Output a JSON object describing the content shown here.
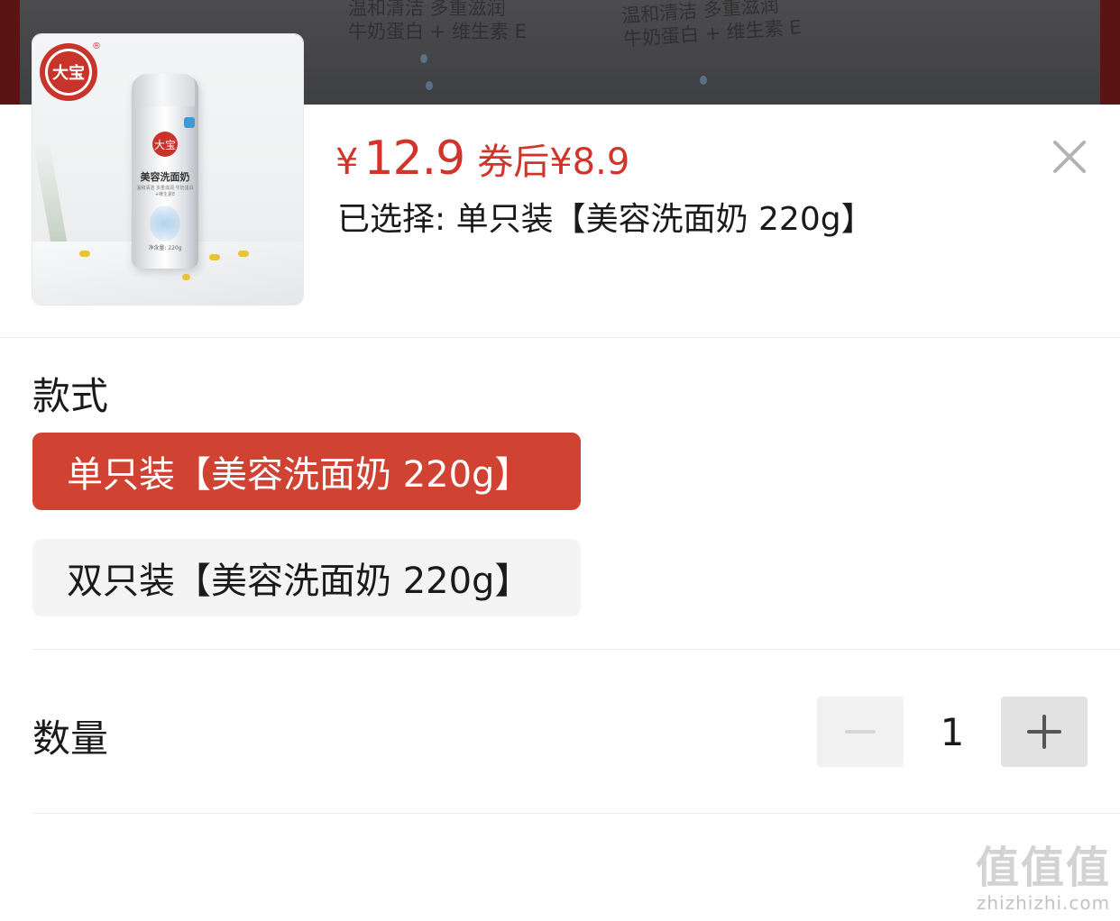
{
  "backdrop": {
    "line1": "温和清洁 多重滋润",
    "line2": "牛奶蛋白 + 维生素 E"
  },
  "product": {
    "image_icon": "product-bottle-image",
    "brand_logo_text": "大宝",
    "registered_mark": "®",
    "bottle_title": "美容洗面奶",
    "bottle_subtitle": "温和清洁 多重滋润 牛奶蛋白+维生素E",
    "bottle_net": "净含量: 220g"
  },
  "price": {
    "currency": "¥",
    "amount": "12.9",
    "coupon_label": "券后¥8.9"
  },
  "selected_text": "已选择: 单只装【美容洗面奶 220g】",
  "close_icon": "close-icon",
  "style_section": {
    "title": "款式",
    "options": [
      {
        "label": "单只装【美容洗面奶 220g】",
        "selected": true
      },
      {
        "label": "双只装【美容洗面奶 220g】",
        "selected": false
      }
    ]
  },
  "quantity_section": {
    "title": "数量",
    "value": "1",
    "minus_icon": "minus-icon",
    "plus_icon": "plus-icon"
  },
  "watermark": {
    "big": "值值值",
    "small": "zhizhizhi.com"
  },
  "colors": {
    "accent": "#d0352b",
    "selected_option_bg": "#d04231",
    "option_bg": "#f4f4f4"
  }
}
